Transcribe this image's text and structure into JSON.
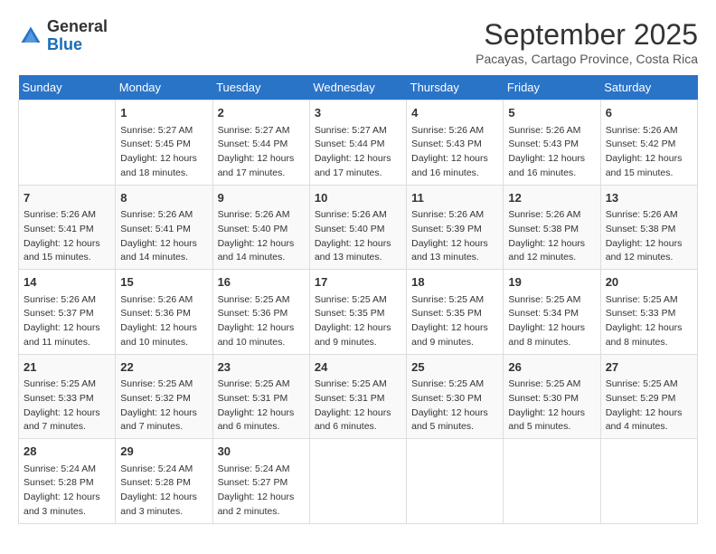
{
  "header": {
    "logo_line1": "General",
    "logo_line2": "Blue",
    "title": "September 2025",
    "subtitle": "Pacayas, Cartago Province, Costa Rica"
  },
  "calendar": {
    "days_of_week": [
      "Sunday",
      "Monday",
      "Tuesday",
      "Wednesday",
      "Thursday",
      "Friday",
      "Saturday"
    ],
    "weeks": [
      [
        {
          "day": "",
          "info": ""
        },
        {
          "day": "1",
          "info": "Sunrise: 5:27 AM\nSunset: 5:45 PM\nDaylight: 12 hours\nand 18 minutes."
        },
        {
          "day": "2",
          "info": "Sunrise: 5:27 AM\nSunset: 5:44 PM\nDaylight: 12 hours\nand 17 minutes."
        },
        {
          "day": "3",
          "info": "Sunrise: 5:27 AM\nSunset: 5:44 PM\nDaylight: 12 hours\nand 17 minutes."
        },
        {
          "day": "4",
          "info": "Sunrise: 5:26 AM\nSunset: 5:43 PM\nDaylight: 12 hours\nand 16 minutes."
        },
        {
          "day": "5",
          "info": "Sunrise: 5:26 AM\nSunset: 5:43 PM\nDaylight: 12 hours\nand 16 minutes."
        },
        {
          "day": "6",
          "info": "Sunrise: 5:26 AM\nSunset: 5:42 PM\nDaylight: 12 hours\nand 15 minutes."
        }
      ],
      [
        {
          "day": "7",
          "info": "Sunrise: 5:26 AM\nSunset: 5:41 PM\nDaylight: 12 hours\nand 15 minutes."
        },
        {
          "day": "8",
          "info": "Sunrise: 5:26 AM\nSunset: 5:41 PM\nDaylight: 12 hours\nand 14 minutes."
        },
        {
          "day": "9",
          "info": "Sunrise: 5:26 AM\nSunset: 5:40 PM\nDaylight: 12 hours\nand 14 minutes."
        },
        {
          "day": "10",
          "info": "Sunrise: 5:26 AM\nSunset: 5:40 PM\nDaylight: 12 hours\nand 13 minutes."
        },
        {
          "day": "11",
          "info": "Sunrise: 5:26 AM\nSunset: 5:39 PM\nDaylight: 12 hours\nand 13 minutes."
        },
        {
          "day": "12",
          "info": "Sunrise: 5:26 AM\nSunset: 5:38 PM\nDaylight: 12 hours\nand 12 minutes."
        },
        {
          "day": "13",
          "info": "Sunrise: 5:26 AM\nSunset: 5:38 PM\nDaylight: 12 hours\nand 12 minutes."
        }
      ],
      [
        {
          "day": "14",
          "info": "Sunrise: 5:26 AM\nSunset: 5:37 PM\nDaylight: 12 hours\nand 11 minutes."
        },
        {
          "day": "15",
          "info": "Sunrise: 5:26 AM\nSunset: 5:36 PM\nDaylight: 12 hours\nand 10 minutes."
        },
        {
          "day": "16",
          "info": "Sunrise: 5:25 AM\nSunset: 5:36 PM\nDaylight: 12 hours\nand 10 minutes."
        },
        {
          "day": "17",
          "info": "Sunrise: 5:25 AM\nSunset: 5:35 PM\nDaylight: 12 hours\nand 9 minutes."
        },
        {
          "day": "18",
          "info": "Sunrise: 5:25 AM\nSunset: 5:35 PM\nDaylight: 12 hours\nand 9 minutes."
        },
        {
          "day": "19",
          "info": "Sunrise: 5:25 AM\nSunset: 5:34 PM\nDaylight: 12 hours\nand 8 minutes."
        },
        {
          "day": "20",
          "info": "Sunrise: 5:25 AM\nSunset: 5:33 PM\nDaylight: 12 hours\nand 8 minutes."
        }
      ],
      [
        {
          "day": "21",
          "info": "Sunrise: 5:25 AM\nSunset: 5:33 PM\nDaylight: 12 hours\nand 7 minutes."
        },
        {
          "day": "22",
          "info": "Sunrise: 5:25 AM\nSunset: 5:32 PM\nDaylight: 12 hours\nand 7 minutes."
        },
        {
          "day": "23",
          "info": "Sunrise: 5:25 AM\nSunset: 5:31 PM\nDaylight: 12 hours\nand 6 minutes."
        },
        {
          "day": "24",
          "info": "Sunrise: 5:25 AM\nSunset: 5:31 PM\nDaylight: 12 hours\nand 6 minutes."
        },
        {
          "day": "25",
          "info": "Sunrise: 5:25 AM\nSunset: 5:30 PM\nDaylight: 12 hours\nand 5 minutes."
        },
        {
          "day": "26",
          "info": "Sunrise: 5:25 AM\nSunset: 5:30 PM\nDaylight: 12 hours\nand 5 minutes."
        },
        {
          "day": "27",
          "info": "Sunrise: 5:25 AM\nSunset: 5:29 PM\nDaylight: 12 hours\nand 4 minutes."
        }
      ],
      [
        {
          "day": "28",
          "info": "Sunrise: 5:24 AM\nSunset: 5:28 PM\nDaylight: 12 hours\nand 3 minutes."
        },
        {
          "day": "29",
          "info": "Sunrise: 5:24 AM\nSunset: 5:28 PM\nDaylight: 12 hours\nand 3 minutes."
        },
        {
          "day": "30",
          "info": "Sunrise: 5:24 AM\nSunset: 5:27 PM\nDaylight: 12 hours\nand 2 minutes."
        },
        {
          "day": "",
          "info": ""
        },
        {
          "day": "",
          "info": ""
        },
        {
          "day": "",
          "info": ""
        },
        {
          "day": "",
          "info": ""
        }
      ]
    ]
  }
}
